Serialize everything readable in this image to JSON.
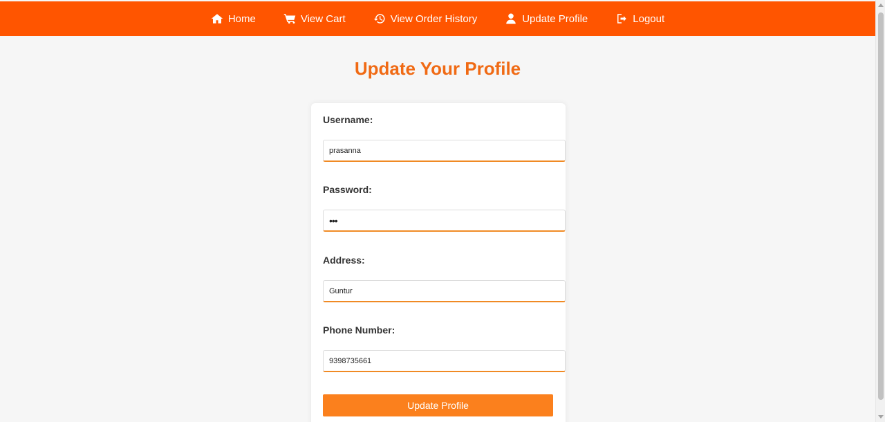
{
  "nav": {
    "items": [
      {
        "label": "Home",
        "icon": "home-icon"
      },
      {
        "label": "View Cart",
        "icon": "cart-icon"
      },
      {
        "label": "View Order History",
        "icon": "history-icon"
      },
      {
        "label": "Update Profile",
        "icon": "user-icon"
      },
      {
        "label": "Logout",
        "icon": "logout-icon"
      }
    ]
  },
  "page": {
    "title": "Update Your Profile"
  },
  "form": {
    "username_label": "Username:",
    "username_value": "prasanna",
    "password_label": "Password:",
    "password_value": "•••",
    "address_label": "Address:",
    "address_value": "Guntur",
    "phone_label": "Phone Number:",
    "phone_value": "9398735661",
    "submit_label": "Update Profile"
  },
  "colors": {
    "navbar": "#ff5500",
    "title": "#f06a14",
    "button": "#fb801d",
    "input_accent": "#f08a24",
    "background": "#f6f6f6"
  }
}
